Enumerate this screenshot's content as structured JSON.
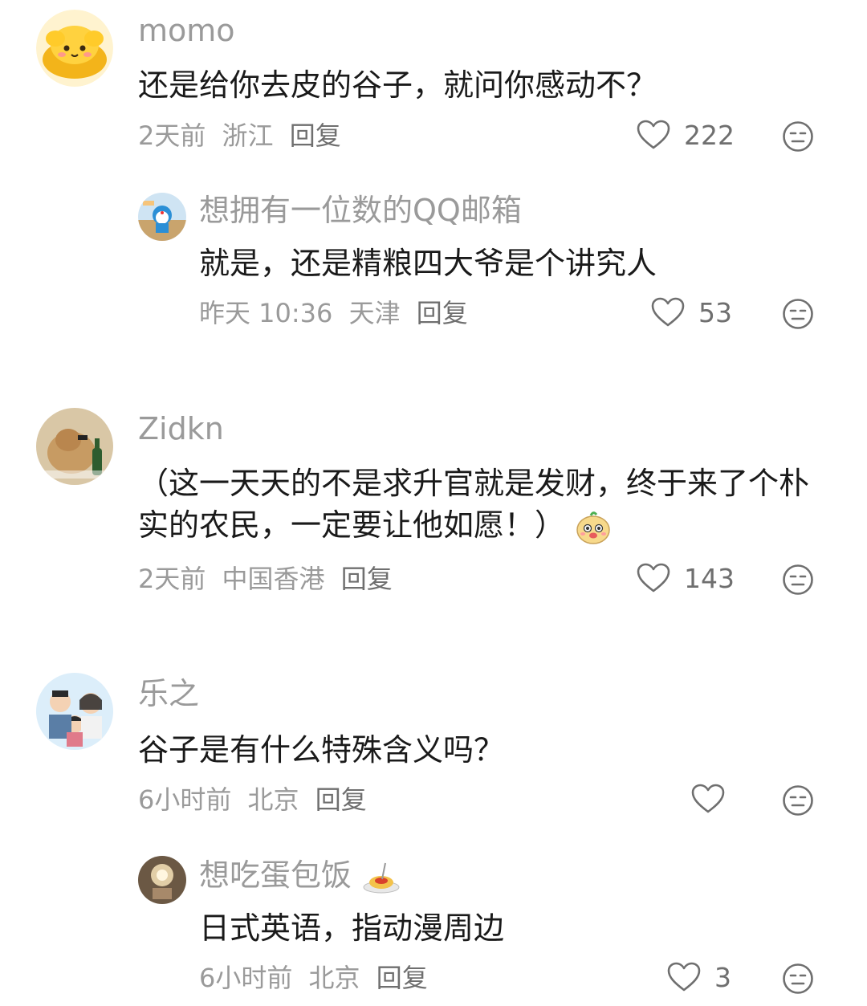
{
  "comments": [
    {
      "user": "momo",
      "text": "还是给你去皮的谷子，就问你感动不？",
      "time": "2天前",
      "location": "浙江",
      "reply_label": "回复",
      "likes": "222",
      "replies": [
        {
          "user": "想拥有一位数的QQ邮箱",
          "text": "就是，还是精粮四大爷是个讲究人",
          "time": "昨天 10:36",
          "location": "天津",
          "reply_label": "回复",
          "likes": "53"
        }
      ]
    },
    {
      "user": "Zidkn",
      "text": "（这一天天的不是求升官就是发财，终于来了个朴实的农民，一定要让他如愿！）",
      "time": "2天前",
      "location": "中国香港",
      "reply_label": "回复",
      "likes": "143"
    },
    {
      "user": "乐之",
      "text": "谷子是有什么特殊含义吗？",
      "time": "6小时前",
      "location": "北京",
      "reply_label": "回复",
      "likes": "",
      "replies": [
        {
          "user": "想吃蛋包饭",
          "text": "日式英语，指动漫周边",
          "time": "6小时前",
          "location": "北京",
          "reply_label": "回复",
          "likes": "3"
        }
      ]
    }
  ],
  "icons": {
    "like": "heart-outline-icon",
    "dislike": "meh-face-icon"
  },
  "colors": {
    "name": "#9a9a9a",
    "text": "#1a1a1a",
    "meta": "#9a9a9a",
    "icon": "#6f6f6f"
  }
}
